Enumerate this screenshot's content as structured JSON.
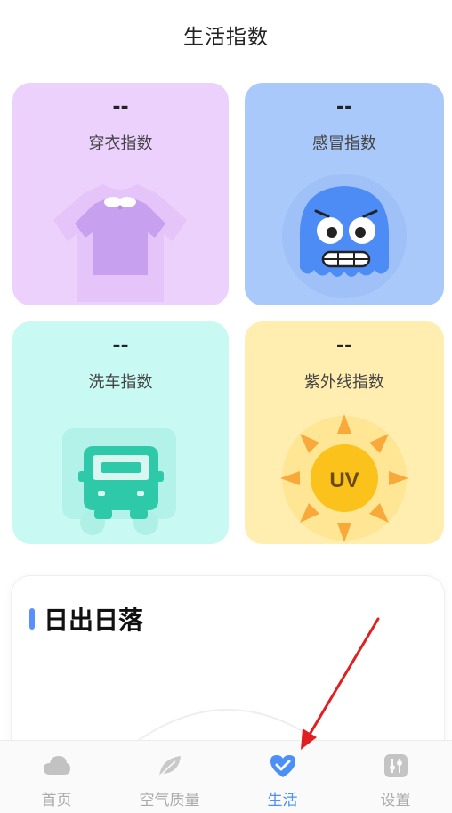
{
  "header": {
    "title": "生活指数"
  },
  "cards": {
    "clothing": {
      "value": "--",
      "label": "穿衣指数",
      "icon": "tshirt-icon"
    },
    "cold": {
      "value": "--",
      "label": "感冒指数",
      "icon": "cold-face-icon"
    },
    "carwash": {
      "value": "--",
      "label": "洗车指数",
      "icon": "car-icon"
    },
    "uv": {
      "value": "--",
      "label": "紫外线指数",
      "icon": "sun-uv-icon",
      "badge": "UV"
    }
  },
  "sunrise": {
    "title": "日出日落"
  },
  "tabbar": {
    "tabs": [
      {
        "label": "首页",
        "icon": "cloud-icon",
        "active": false
      },
      {
        "label": "空气质量",
        "icon": "leaf-icon",
        "active": false
      },
      {
        "label": "生活",
        "icon": "heart-check-icon",
        "active": true
      },
      {
        "label": "设置",
        "icon": "settings-icon",
        "active": false
      }
    ]
  },
  "colors": {
    "clothing_bg": "#ecd1fd",
    "cold_bg": "#a9c9fb",
    "carwash_bg": "#c9f9f3",
    "uv_bg": "#ffeeaf",
    "accent": "#4b8ff7",
    "annotation_arrow": "#e02020"
  }
}
